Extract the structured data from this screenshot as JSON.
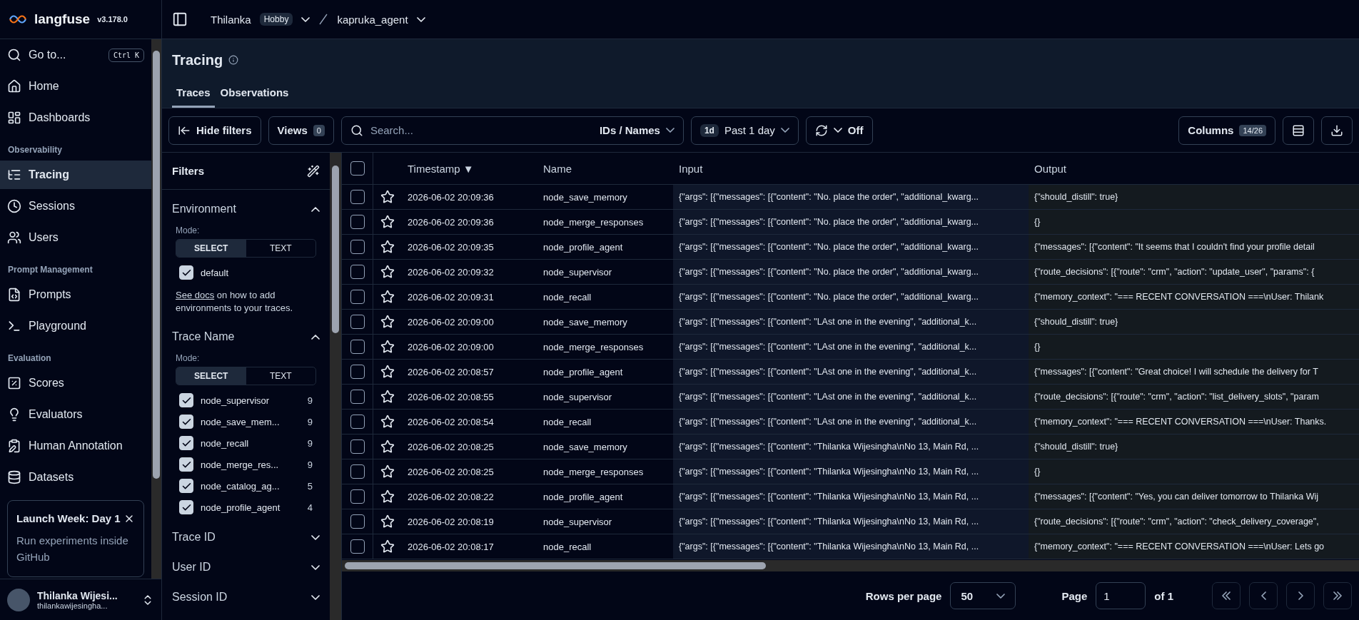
{
  "app": {
    "name": "langfuse",
    "version": "v3.178.0"
  },
  "sidebar": {
    "goto": {
      "label": "Go to...",
      "shortcut": "Ctrl K"
    },
    "sections": [
      {
        "items": [
          {
            "label": "Home",
            "selected": false
          },
          {
            "label": "Dashboards",
            "selected": false
          }
        ]
      },
      {
        "title": "Observability",
        "items": [
          {
            "label": "Tracing",
            "selected": true
          },
          {
            "label": "Sessions",
            "selected": false
          },
          {
            "label": "Users",
            "selected": false
          }
        ]
      },
      {
        "title": "Prompt Management",
        "items": [
          {
            "label": "Prompts",
            "selected": false
          },
          {
            "label": "Playground",
            "selected": false
          }
        ]
      },
      {
        "title": "Evaluation",
        "items": [
          {
            "label": "Scores",
            "selected": false
          },
          {
            "label": "Evaluators",
            "selected": false
          },
          {
            "label": "Human Annotation",
            "selected": false
          },
          {
            "label": "Datasets",
            "selected": false
          }
        ]
      }
    ],
    "promo": {
      "title": "Launch Week: Day 1",
      "text": "Run experiments inside GitHub"
    },
    "user": {
      "name": "Thilanka Wijesi...",
      "email": "thilankawijesingha..."
    }
  },
  "breadcrumb": {
    "org": "Thilanka",
    "plan": "Hobby",
    "project": "kapruka_agent"
  },
  "page": {
    "title": "Tracing",
    "tabs": [
      {
        "label": "Traces",
        "selected": true
      },
      {
        "label": "Observations",
        "selected": false
      }
    ]
  },
  "toolbar": {
    "hide_filters": "Hide filters",
    "views": {
      "label": "Views",
      "count": "0"
    },
    "search": {
      "placeholder": "Search...",
      "scope": "IDs / Names"
    },
    "time": {
      "badge": "1d",
      "label": "Past 1 day"
    },
    "refresh": "Off",
    "columns": {
      "label": "Columns",
      "count": "14/26"
    }
  },
  "filters": {
    "title": "Filters",
    "sections": [
      {
        "title": "Environment",
        "expanded": true,
        "mode_label": "Mode:",
        "modes": [
          {
            "label": "SELECT",
            "selected": true
          },
          {
            "label": "TEXT",
            "selected": false
          }
        ],
        "options": [
          {
            "label": "default",
            "checked": true
          }
        ],
        "note": {
          "link": "See docs",
          "text": " on how to add environments to your traces."
        }
      },
      {
        "title": "Trace Name",
        "expanded": true,
        "mode_label": "Mode:",
        "modes": [
          {
            "label": "SELECT",
            "selected": true
          },
          {
            "label": "TEXT",
            "selected": false
          }
        ],
        "options": [
          {
            "label": "node_supervisor",
            "count": "9",
            "checked": true
          },
          {
            "label": "node_save_mem...",
            "count": "9",
            "checked": true
          },
          {
            "label": "node_recall",
            "count": "9",
            "checked": true
          },
          {
            "label": "node_merge_res...",
            "count": "9",
            "checked": true
          },
          {
            "label": "node_catalog_ag...",
            "count": "5",
            "checked": true
          },
          {
            "label": "node_profile_agent",
            "count": "4",
            "checked": true
          }
        ]
      },
      {
        "title": "Trace ID",
        "expanded": false
      },
      {
        "title": "User ID",
        "expanded": false
      },
      {
        "title": "Session ID",
        "expanded": false
      }
    ]
  },
  "table": {
    "all_checked": false,
    "columns": [
      {
        "label": "Timestamp",
        "sort": "▼"
      },
      {
        "label": "Name"
      },
      {
        "label": "Input"
      },
      {
        "label": "Output"
      }
    ],
    "rows": [
      {
        "checked": false,
        "starred": false,
        "timestamp": "2026-06-02 20:09:36",
        "name": "node_save_memory",
        "input": "{\"args\": [{\"messages\": [{\"content\": \"No. place the order\", \"additional_kwarg...",
        "output": "{\"should_distill\": true}"
      },
      {
        "checked": false,
        "starred": false,
        "timestamp": "2026-06-02 20:09:36",
        "name": "node_merge_responses",
        "input": "{\"args\": [{\"messages\": [{\"content\": \"No. place the order\", \"additional_kwarg...",
        "output": "{}"
      },
      {
        "checked": false,
        "starred": false,
        "timestamp": "2026-06-02 20:09:35",
        "name": "node_profile_agent",
        "input": "{\"args\": [{\"messages\": [{\"content\": \"No. place the order\", \"additional_kwarg...",
        "output": "{\"messages\": [{\"content\": \"It seems that I couldn't find your profile detail"
      },
      {
        "checked": false,
        "starred": false,
        "timestamp": "2026-06-02 20:09:32",
        "name": "node_supervisor",
        "input": "{\"args\": [{\"messages\": [{\"content\": \"No. place the order\", \"additional_kwarg...",
        "output": "{\"route_decisions\": [{\"route\": \"crm\", \"action\": \"update_user\", \"params\": {"
      },
      {
        "checked": false,
        "starred": false,
        "timestamp": "2026-06-02 20:09:31",
        "name": "node_recall",
        "input": "{\"args\": [{\"messages\": [{\"content\": \"No. place the order\", \"additional_kwarg...",
        "output": "{\"memory_context\": \"=== RECENT CONVERSATION ===\\nUser: Thilank"
      },
      {
        "checked": false,
        "starred": false,
        "timestamp": "2026-06-02 20:09:00",
        "name": "node_save_memory",
        "input": "{\"args\": [{\"messages\": [{\"content\": \"LAst one in the evening\", \"additional_k...",
        "output": "{\"should_distill\": true}"
      },
      {
        "checked": false,
        "starred": false,
        "timestamp": "2026-06-02 20:09:00",
        "name": "node_merge_responses",
        "input": "{\"args\": [{\"messages\": [{\"content\": \"LAst one in the evening\", \"additional_k...",
        "output": "{}"
      },
      {
        "checked": false,
        "starred": false,
        "timestamp": "2026-06-02 20:08:57",
        "name": "node_profile_agent",
        "input": "{\"args\": [{\"messages\": [{\"content\": \"LAst one in the evening\", \"additional_k...",
        "output": "{\"messages\": [{\"content\": \"Great choice! I will schedule the delivery for T"
      },
      {
        "checked": false,
        "starred": false,
        "timestamp": "2026-06-02 20:08:55",
        "name": "node_supervisor",
        "input": "{\"args\": [{\"messages\": [{\"content\": \"LAst one in the evening\", \"additional_k...",
        "output": "{\"route_decisions\": [{\"route\": \"crm\", \"action\": \"list_delivery_slots\", \"param"
      },
      {
        "checked": false,
        "starred": false,
        "timestamp": "2026-06-02 20:08:54",
        "name": "node_recall",
        "input": "{\"args\": [{\"messages\": [{\"content\": \"LAst one in the evening\", \"additional_k...",
        "output": "{\"memory_context\": \"=== RECENT CONVERSATION ===\\nUser: Thanks."
      },
      {
        "checked": false,
        "starred": false,
        "timestamp": "2026-06-02 20:08:25",
        "name": "node_save_memory",
        "input": "{\"args\": [{\"messages\": [{\"content\": \"Thilanka Wijesingha\\nNo 13, Main Rd, ...",
        "output": "{\"should_distill\": true}"
      },
      {
        "checked": false,
        "starred": false,
        "timestamp": "2026-06-02 20:08:25",
        "name": "node_merge_responses",
        "input": "{\"args\": [{\"messages\": [{\"content\": \"Thilanka Wijesingha\\nNo 13, Main Rd, ...",
        "output": "{}"
      },
      {
        "checked": false,
        "starred": false,
        "timestamp": "2026-06-02 20:08:22",
        "name": "node_profile_agent",
        "input": "{\"args\": [{\"messages\": [{\"content\": \"Thilanka Wijesingha\\nNo 13, Main Rd, ...",
        "output": "{\"messages\": [{\"content\": \"Yes, you can deliver tomorrow to Thilanka Wij"
      },
      {
        "checked": false,
        "starred": false,
        "timestamp": "2026-06-02 20:08:19",
        "name": "node_supervisor",
        "input": "{\"args\": [{\"messages\": [{\"content\": \"Thilanka Wijesingha\\nNo 13, Main Rd, ...",
        "output": "{\"route_decisions\": [{\"route\": \"crm\", \"action\": \"check_delivery_coverage\","
      },
      {
        "checked": false,
        "starred": false,
        "timestamp": "2026-06-02 20:08:17",
        "name": "node_recall",
        "input": "{\"args\": [{\"messages\": [{\"content\": \"Thilanka Wijesingha\\nNo 13, Main Rd, ...",
        "output": "{\"memory_context\": \"=== RECENT CONVERSATION ===\\nUser: Lets go"
      }
    ]
  },
  "pagination": {
    "rows_label": "Rows per page",
    "rows": "50",
    "page_label": "Page",
    "page": "1",
    "of": "of 1"
  }
}
